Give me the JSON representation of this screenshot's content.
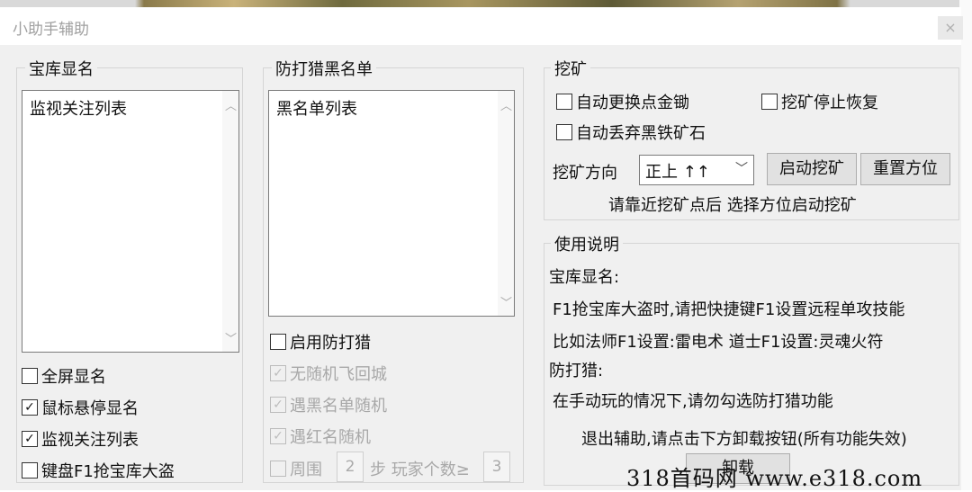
{
  "window": {
    "title": "小助手辅助",
    "close_label": "×"
  },
  "treasure": {
    "group_title": "宝库显名",
    "list_item": "监视关注列表",
    "checkboxes": [
      {
        "label": "全屏显名",
        "checked": false
      },
      {
        "label": "鼠标悬停显名",
        "checked": true
      },
      {
        "label": "监视关注列表",
        "checked": true
      },
      {
        "label": "键盘F1抢宝库大盗",
        "checked": false
      }
    ]
  },
  "blacklist": {
    "group_title": "防打猎黑名单",
    "list_item": "黑名单列表",
    "enable_label": "启用防打猎",
    "enable_checked": false,
    "options": [
      {
        "label": "无随机飞回城",
        "checked": true
      },
      {
        "label": "遇黑名单随机",
        "checked": true
      },
      {
        "label": "遇红名随机",
        "checked": true
      }
    ],
    "around": {
      "label": "周围",
      "steps_value": "2",
      "steps_label": "步 玩家个数≥",
      "count_value": "3"
    }
  },
  "mining": {
    "group_title": "挖矿",
    "auto_pickaxe": "自动更换点金锄",
    "stop_resume": "挖矿停止恢复",
    "auto_discard": "自动丢弃黑铁矿石",
    "direction_label": "挖矿方向",
    "direction_value": "正上 ↑↑",
    "start_button": "启动挖矿",
    "reset_button": "重置方位",
    "hint": "请靠近挖矿点后 选择方位启动挖矿"
  },
  "usage": {
    "group_title": "使用说明",
    "lines": [
      "宝库显名:",
      "F1抢宝库大盗时,请把快捷键F1设置远程单攻技能",
      "比如法师F1设置:雷电术  道士F1设置:灵魂火符",
      "防打猎:",
      "在手动玩的情况下,请勿勾选防打猎功能",
      "退出辅助,请点击下方卸载按钮(所有功能失效)"
    ],
    "unload_button": "卸载"
  },
  "watermark": "318首码网  www.e318.com"
}
